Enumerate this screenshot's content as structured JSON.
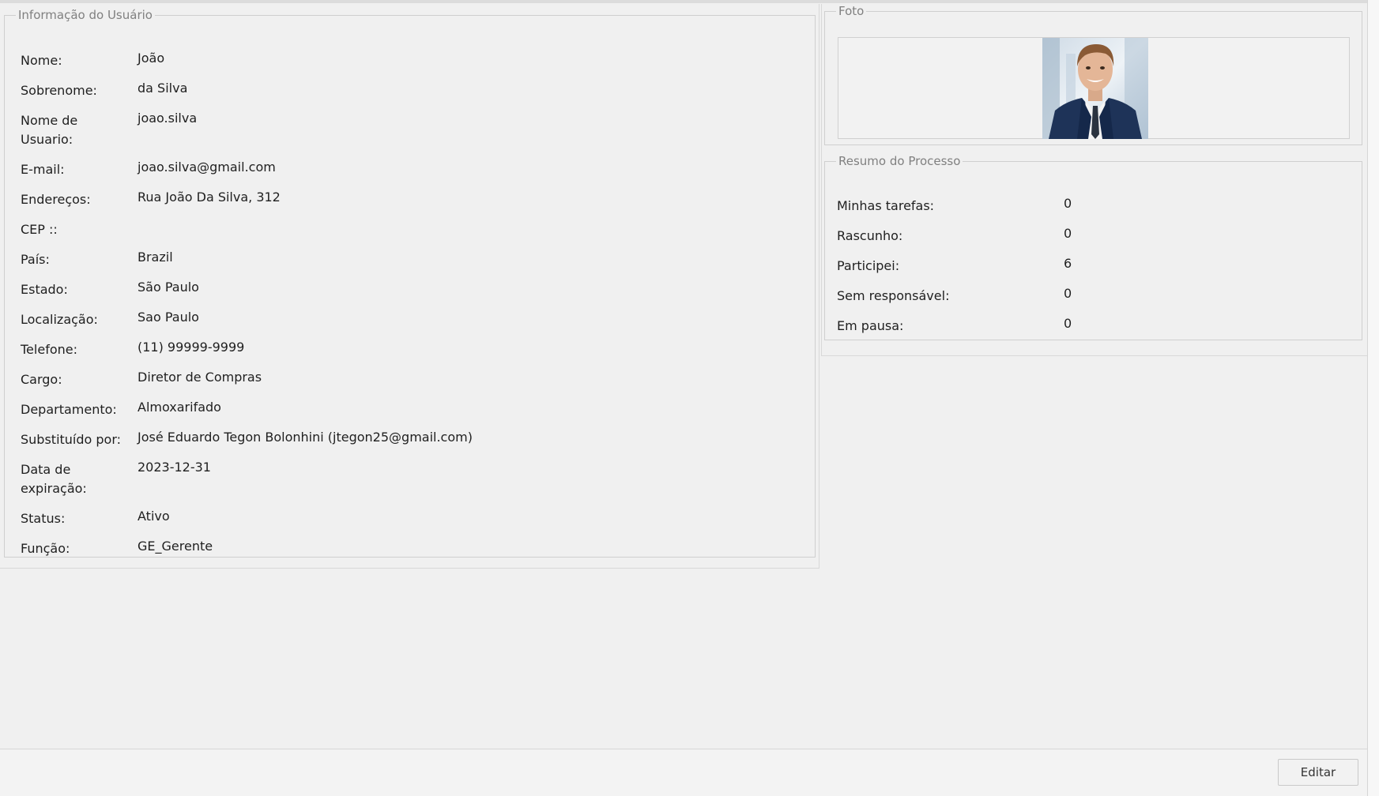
{
  "user_info": {
    "legend": "Informação do Usuário",
    "rows": [
      {
        "label": "Nome:",
        "value": "João"
      },
      {
        "label": "Sobrenome:",
        "value": "da Silva"
      },
      {
        "label": "Nome de Usuario:",
        "value": "joao.silva"
      },
      {
        "label": "E-mail:",
        "value": "joao.silva@gmail.com"
      },
      {
        "label": "Endereços:",
        "value": "Rua João Da Silva, 312"
      },
      {
        "label": "CEP ::",
        "value": ""
      },
      {
        "label": "País:",
        "value": "Brazil"
      },
      {
        "label": "Estado:",
        "value": "São Paulo"
      },
      {
        "label": "Localização:",
        "value": "Sao Paulo"
      },
      {
        "label": "Telefone:",
        "value": "(11) 99999-9999"
      },
      {
        "label": "Cargo:",
        "value": "Diretor de Compras"
      },
      {
        "label": "Departamento:",
        "value": "Almoxarifado"
      },
      {
        "label": "Substituído por:",
        "value": "José Eduardo Tegon Bolonhini (jtegon25@gmail.com)"
      },
      {
        "label": "Data de expiração:",
        "value": "2023-12-31"
      },
      {
        "label": "Status:",
        "value": "Ativo"
      },
      {
        "label": "Função:",
        "value": "GE_Gerente"
      }
    ]
  },
  "photo": {
    "legend": "Foto",
    "image": "user-profile-photo"
  },
  "summary": {
    "legend": "Resumo do Processo",
    "rows": [
      {
        "label": "Minhas tarefas:",
        "value": "0"
      },
      {
        "label": "Rascunho:",
        "value": "0"
      },
      {
        "label": "Participei:",
        "value": "6"
      },
      {
        "label": "Sem responsável:",
        "value": "0"
      },
      {
        "label": "Em pausa:",
        "value": "0"
      }
    ]
  },
  "actions": {
    "edit_label": "Editar"
  }
}
